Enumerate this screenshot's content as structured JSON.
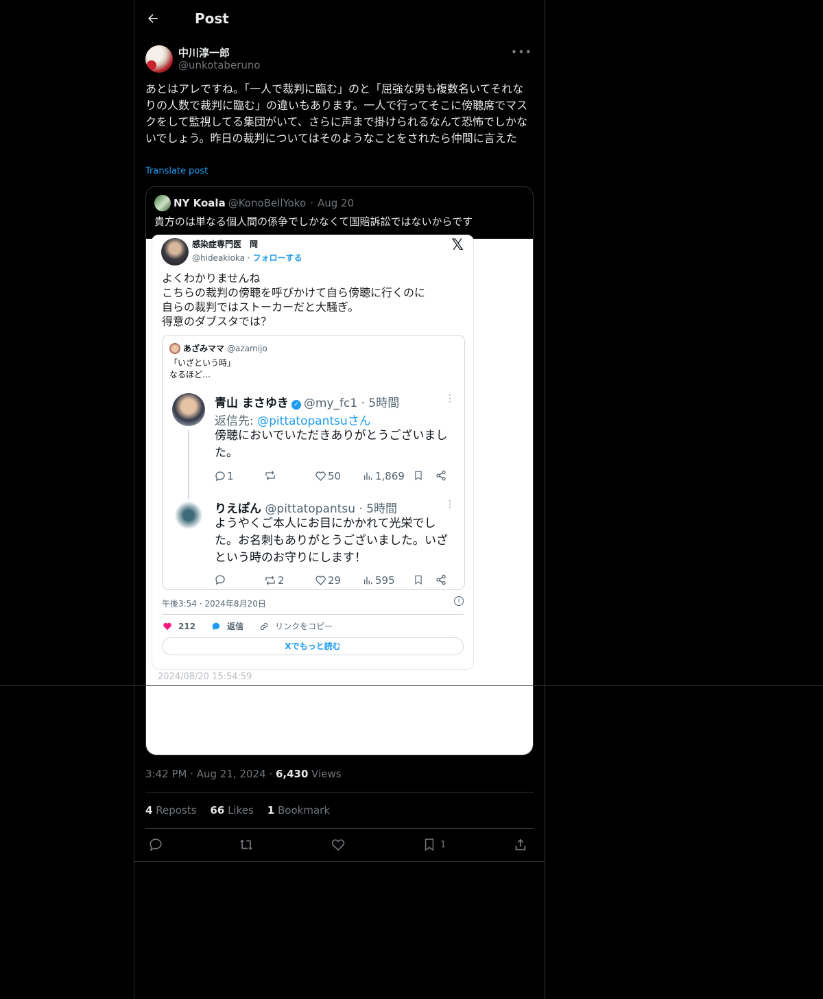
{
  "header": {
    "title": "Post"
  },
  "post": {
    "author_name": "中川淳一郎",
    "author_handle": "@unkotaberuno",
    "text": "あとはアレですね。「一人で裁判に臨む」のと「屈強な男も複数名いてそれなりの人数で裁判に臨む」の違いもあります。一人で行ってそこに傍聴席でマスクをして監視してる集団がいて、さらに声まで掛けられるなんて恐怖でしかないでしょう。昨日の裁判についてはそのようなことをされたら仲間に言えた",
    "translate_label": "Translate post"
  },
  "quote": {
    "name": "NY Koala",
    "handle": "@KonoBellYoko",
    "date": "Aug 20",
    "text": "貴方のは単なる個人間の係争でしかなくて国賠訴訟ではないからです"
  },
  "embed": {
    "name": "感染症専門医　岡",
    "handle": "@hideakioka",
    "follow": "フォローする",
    "x_logo": "𝕏",
    "text": "よくわかりませんね\nこちらの裁判の傍聴を呼びかけて自ら傍聴に行くのに\n自らの裁判ではストーカーだと大騒ぎ。\n得意のダブスタでは？",
    "inner": {
      "name": "あざみママ",
      "handle": "@azamijo",
      "text": "「いざという時」\nなるほど…",
      "tweet1": {
        "name": "青山 まさゆき",
        "handle": "@my_fc1 · 5時間",
        "reply_prefix": "返信先: ",
        "reply_to": "@pittatopantsuさん",
        "text": "傍聴においでいただきありがとうございました。",
        "replies": "1",
        "likes": "50",
        "views": "1,869"
      },
      "tweet2": {
        "name": "りえぽん",
        "handle": "@pittatopantsu · 5時間",
        "text": "ようやくご本人にお目にかかれて光栄でした。お名刺もありがとうございました。いざという時のお守りにします！",
        "retweets": "2",
        "likes": "29",
        "views": "595"
      }
    },
    "time": "午後3:54 · 2024年8月20日",
    "like_count": "212",
    "reply_label": "返信",
    "copy_link_label": "リンクをコピー",
    "read_more": "Xでもっと読む",
    "watermark": "2024/08/20 15:54:59"
  },
  "meta": {
    "time": "3:42 PM",
    "date": "Aug 21, 2024",
    "views": "6,430",
    "views_label": "Views"
  },
  "counts": {
    "reposts": "4",
    "reposts_label": "Reposts",
    "likes": "66",
    "likes_label": "Likes",
    "bookmarks": "1",
    "bookmarks_label": "Bookmark"
  },
  "actions": {
    "bookmark_count": "1"
  },
  "colors": {
    "background": "#000000",
    "accent": "#1d9bf0",
    "border": "#2f3336",
    "muted": "#71767b"
  }
}
